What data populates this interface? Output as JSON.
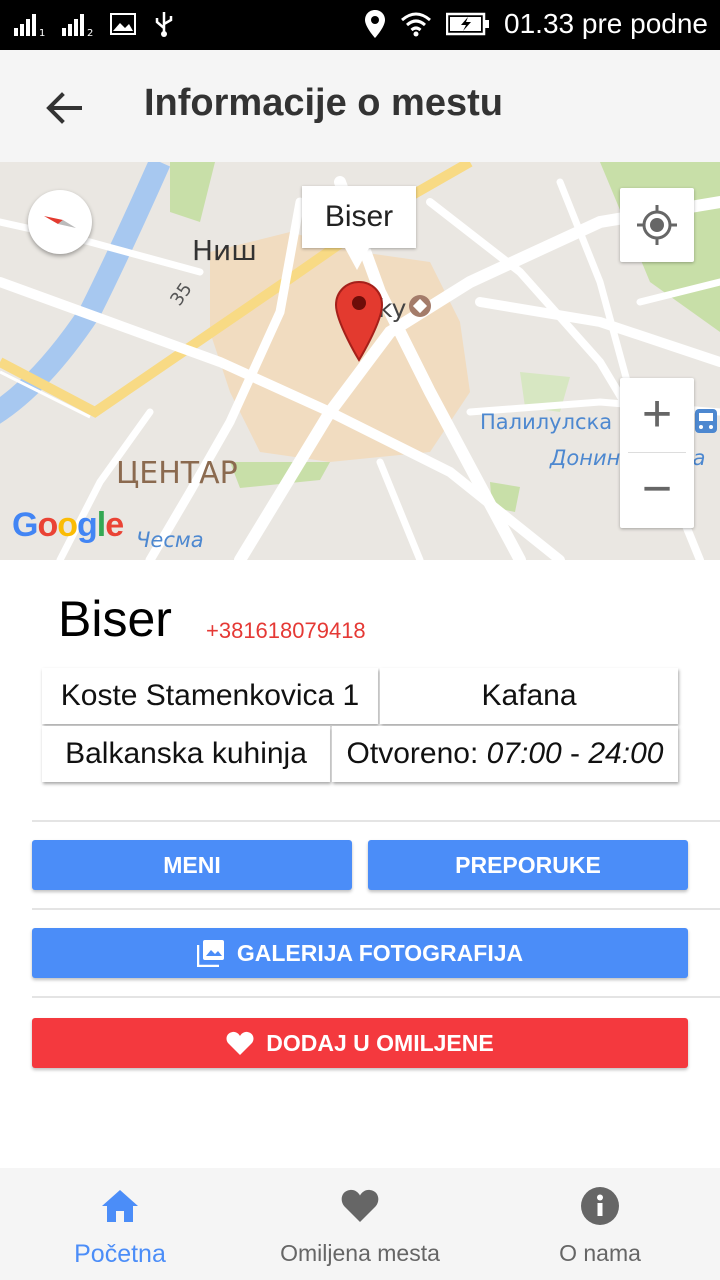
{
  "status_bar": {
    "time": "01.33 pre podne"
  },
  "toolbar": {
    "title": "Informacije o mestu",
    "back_icon": "arrow-back-icon"
  },
  "map": {
    "info_window": "Biser",
    "labels": {
      "city": "Ниш",
      "center": "ЦЕНТАР",
      "road": "35",
      "palilulska": "Палилулска рампа",
      "donina": "Донина чесма",
      "cesma": "Чесма",
      "poi_partial": "ky"
    },
    "attribution": "Google",
    "zoom_in": "+",
    "zoom_out": "−"
  },
  "place": {
    "name": "Biser",
    "phone": "+381618079418",
    "address": "Koste Stamenkovica 1",
    "type": "Kafana",
    "cuisine": "Balkanska kuhinja",
    "hours_label": "Otvoreno:",
    "hours_open": "07:00",
    "hours_sep": " - ",
    "hours_close": "24:00"
  },
  "buttons": {
    "menu": "MENI",
    "recommendations": "PREPORUKE",
    "gallery": "GALERIJA FOTOGRAFIJA",
    "favorite": "DODAJ U OMILJENE"
  },
  "bottom_nav": [
    {
      "label": "Početna",
      "icon": "home-icon",
      "active": true
    },
    {
      "label": "Omiljena mesta",
      "icon": "heart-icon",
      "active": false
    },
    {
      "label": "O nama",
      "icon": "info-icon",
      "active": false
    }
  ],
  "colors": {
    "accent": "#4b8df8",
    "danger": "#f4393e",
    "phone": "#e53935"
  }
}
